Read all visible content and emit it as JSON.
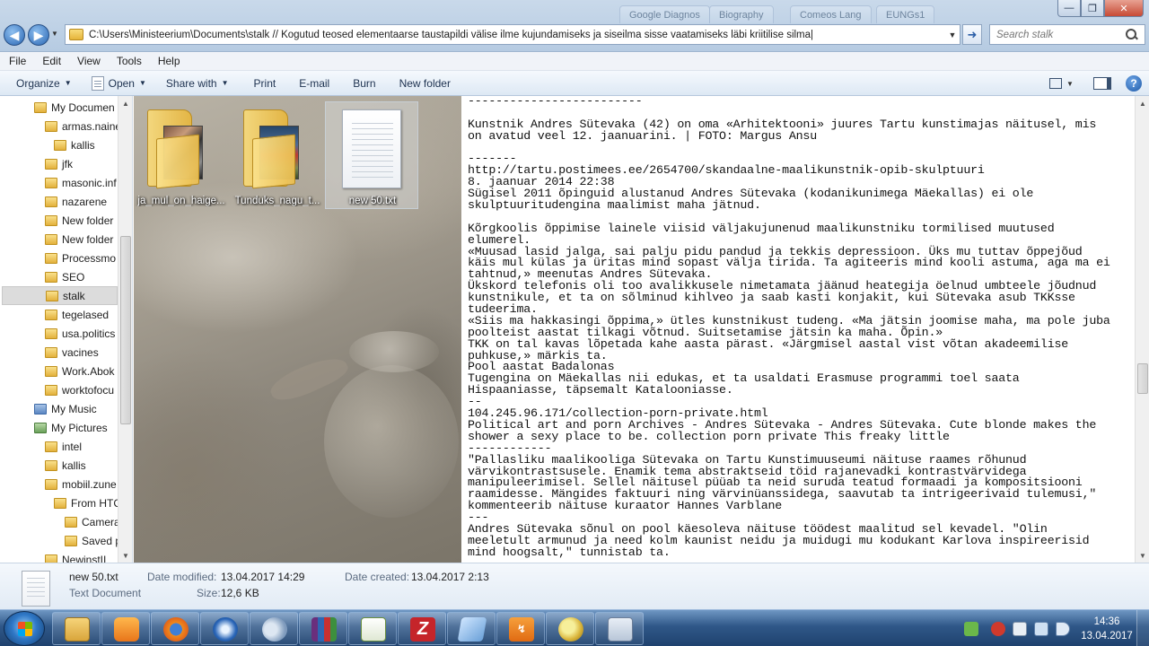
{
  "browser": {
    "ghost_tabs": [
      "Google Diagnos",
      "Biography",
      "Comeos Lang",
      "EUNGs1"
    ]
  },
  "window": {
    "min_label": "—",
    "max_label": "❐",
    "close_label": "✕"
  },
  "address": {
    "path": "C:\\Users\\Ministeerium\\Documents\\stalk   // Kogutud teosed elementaarse taustapildi välise ilme kujundamiseks ja siseilma sisse vaatamiseks läbi kriitilise silma|",
    "back_label": "◀",
    "forward_label": "▶",
    "go_label": "➜"
  },
  "search": {
    "placeholder": "Search stalk"
  },
  "menu": [
    "File",
    "Edit",
    "View",
    "Tools",
    "Help"
  ],
  "commands": {
    "organize": "Organize",
    "open": "Open",
    "share_with": "Share with",
    "print": "Print",
    "email": "E-mail",
    "burn": "Burn",
    "new_folder": "New folder",
    "help": "?"
  },
  "nav_tree": [
    {
      "label": "My Documen",
      "icon": "folder-icon",
      "indent": 1
    },
    {
      "label": "armas.naine",
      "icon": "folder-icon",
      "indent": 2
    },
    {
      "label": "kallis",
      "icon": "folder-icon",
      "indent": 3
    },
    {
      "label": "jfk",
      "icon": "folder-icon",
      "indent": 2
    },
    {
      "label": "masonic.inf",
      "icon": "folder-icon",
      "indent": 2
    },
    {
      "label": "nazarene",
      "icon": "folder-icon",
      "indent": 2
    },
    {
      "label": "New folder",
      "icon": "folder-icon",
      "indent": 2
    },
    {
      "label": "New folder",
      "icon": "folder-icon",
      "indent": 2
    },
    {
      "label": "Processmo",
      "icon": "folder-icon",
      "indent": 2
    },
    {
      "label": "SEO",
      "icon": "folder-icon",
      "indent": 2
    },
    {
      "label": "stalk",
      "icon": "folder-icon",
      "indent": 2,
      "selected": true
    },
    {
      "label": "tegelased",
      "icon": "folder-icon",
      "indent": 2
    },
    {
      "label": "usa.politics",
      "icon": "folder-icon",
      "indent": 2
    },
    {
      "label": "vacines",
      "icon": "folder-icon",
      "indent": 2
    },
    {
      "label": "Work.Abok",
      "icon": "folder-icon",
      "indent": 2
    },
    {
      "label": "worktofocu",
      "icon": "folder-icon",
      "indent": 2
    },
    {
      "label": "My Music",
      "icon": "music-library-icon",
      "indent": 1
    },
    {
      "label": "My Pictures",
      "icon": "pictures-library-icon",
      "indent": 1
    },
    {
      "label": "intel",
      "icon": "folder-icon",
      "indent": 2
    },
    {
      "label": "kallis",
      "icon": "folder-icon",
      "indent": 2
    },
    {
      "label": "mobiil.zune",
      "icon": "folder-icon",
      "indent": 2
    },
    {
      "label": "From HTC",
      "icon": "folder-icon",
      "indent": 3
    },
    {
      "label": "Camera",
      "icon": "folder-icon",
      "indent": 4
    },
    {
      "label": "Saved pic",
      "icon": "folder-icon",
      "indent": 4
    },
    {
      "label": "NewinstII",
      "icon": "folder-icon",
      "indent": 2
    }
  ],
  "files": [
    {
      "name": "ja_mul_on_haige...",
      "type": "folder"
    },
    {
      "name": "Tunduks_nagu_t...",
      "type": "folder"
    },
    {
      "name": "new 50.txt",
      "type": "text",
      "selected": true
    }
  ],
  "preview": {
    "lines": [
      "-------------------------",
      "",
      "Kunstnik Andres Sütevaka (42) on oma «Arhitektooni» juures Tartu kunstimajas näitusel, mis",
      "on avatud veel 12. jaanuarini. | FOTO: Margus Ansu",
      "",
      "-------",
      "http://tartu.postimees.ee/2654700/skandaalne-maalikunstnik-opib-skulptuuri",
      "8. jaanuar 2014 22:38",
      "Sügisel 2011 õpinguid alustanud Andres Sütevaka (kodanikunimega Mäekallas) ei ole",
      "skulptuuritudengina maalimist maha jätnud.",
      "",
      "Kõrgkoolis õppimise lainele viisid väljakujunenud maalikunstniku tormilised muutused",
      "elumerel.",
      "«Muusad lasid jalga, sai palju pidu pandud ja tekkis depressioon. Üks mu tuttav õppejõud",
      "käis mul külas ja üritas mind sopast välja tirida. Ta agiteeris mind kooli astuma, aga ma ei",
      "tahtnud,» meenutas Andres Sütevaka.",
      "Ükskord telefonis oli too avalikkusele nimetamata jäänud heategija öelnud umbteele jõudnud",
      "kunstnikule, et ta on sõlminud kihlveo ja saab kasti konjakit, kui Sütevaka asub TKKsse",
      "tudeerima.",
      "«Siis ma hakkasingi õppima,» ütles kunstnikust tudeng. «Ma jätsin joomise maha, ma pole juba",
      "poolteist aastat tilkagi võtnud. Suitsetamise jätsin ka maha. Õpin.»",
      "TKK on tal kavas lõpetada kahe aasta pärast. «Järgmisel aastal vist võtan akadeemilise",
      "puhkuse,» märkis ta.",
      "Pool aastat Badalonas",
      "Tugengina on Mäekallas nii edukas, et ta usaldati Erasmuse programmi toel saata",
      "Hispaaniasse, täpsemalt Katalooniasse.",
      "--",
      "104.245.96.171/collection-porn-private.html",
      "Political art and porn Archives - Andres Sütevaka - Andres Sütevaka. Cute blonde makes the",
      "shower a sexy place to be. collection porn private This freaky little",
      "------------",
      "\"Pallasliku maalikooliga Sütevaka on Tartu Kunstimuuseumi näituse raames rõhunud",
      "värvikontrastsusele. Enamik tema abstraktseid töid rajanevadki kontrastvärvidega",
      "manipuleerimisel. Sellel näitusel püüab ta neid suruda teatud formaadi ja kompositsiooni",
      "raamidesse. Mängides faktuuri ning värvinüanssidega, saavutab ta intrigeerivaid tulemusi,\"",
      "kommenteerib näituse kuraator Hannes Varblane",
      "---",
      "Andres Sütevaka sõnul on pool käesoleva näituse töödest maalitud sel kevadel. \"Olin",
      "meeletult armunud ja need kolm kaunist neidu ja muidugi mu kodukant Karlova inspireerisid",
      "mind hoogsalt,\" tunnistab ta."
    ]
  },
  "details": {
    "filename": "new 50.txt",
    "filetype": "Text Document",
    "modified_label": "Date modified:",
    "modified_value": "13.04.2017 14:29",
    "created_label": "Date created:",
    "created_value": "13.04.2017 2:13",
    "size_label": "Size:",
    "size_value": "12,6 KB"
  },
  "taskbar": {
    "apps": [
      {
        "name": "explorer-icon",
        "glyph": "g-explorer"
      },
      {
        "name": "media-player-icon",
        "glyph": "g-media"
      },
      {
        "name": "firefox-icon",
        "glyph": "g-firefox"
      },
      {
        "name": "thunderbird-icon",
        "glyph": "g-thunder"
      },
      {
        "name": "network-icon",
        "glyph": "g-network"
      },
      {
        "name": "winrar-icon",
        "glyph": "g-winrar"
      },
      {
        "name": "notepad-plus-icon",
        "glyph": "g-notepad"
      },
      {
        "name": "filezilla-icon",
        "glyph": "g-filezilla",
        "text": "Z"
      },
      {
        "name": "notepad-icon",
        "glyph": "g-notepad2"
      },
      {
        "name": "sync-app-icon",
        "glyph": "g-sync",
        "text": "↯"
      },
      {
        "name": "search-app-icon",
        "glyph": "g-search"
      },
      {
        "name": "calculator-icon",
        "glyph": "g-calc"
      }
    ],
    "clock_time": "14:36",
    "clock_date": "13.04.2017"
  }
}
